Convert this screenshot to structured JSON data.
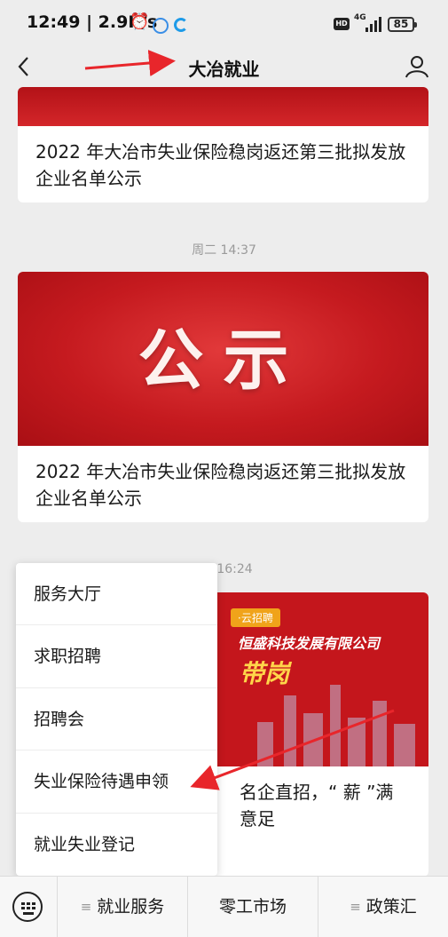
{
  "status_bar": {
    "time": "12:49",
    "speed": "2.9K/s",
    "hd_badge": "HD",
    "network": "4G",
    "battery": "85"
  },
  "header": {
    "title": "大冶就业",
    "back_icon": "chevron-left-icon",
    "profile_icon": "user-icon"
  },
  "feed": [
    {
      "caption": "2022 年大冶市失业保险稳岗返还第三批拟发放企业名单公示"
    },
    {
      "timestamp": "周二 14:37",
      "image_text": "公示",
      "caption": "2022 年大冶市失业保险稳岗返还第三批拟发放企业名单公示"
    },
    {
      "timestamp": "16:24",
      "image_tag": "·云招聘",
      "image_company": "恒盛科技发展有限公司",
      "image_headline": "带岗",
      "caption": "名企直招，“ 薪 ”满意足"
    }
  ],
  "menu": {
    "items": [
      "服务大厅",
      "求职招聘",
      "招聘会",
      "失业保险待遇申领",
      "就业失业登记"
    ]
  },
  "bottom_bar": {
    "keyboard_icon": "keyboard-icon",
    "tabs": [
      {
        "label": "就业服务",
        "has_submenu": true
      },
      {
        "label": "零工市场",
        "has_submenu": false
      },
      {
        "label": "政策汇",
        "has_submenu": true
      }
    ]
  },
  "colors": {
    "accent_red": "#c4161c",
    "annotation_arrow": "#e8262b"
  }
}
